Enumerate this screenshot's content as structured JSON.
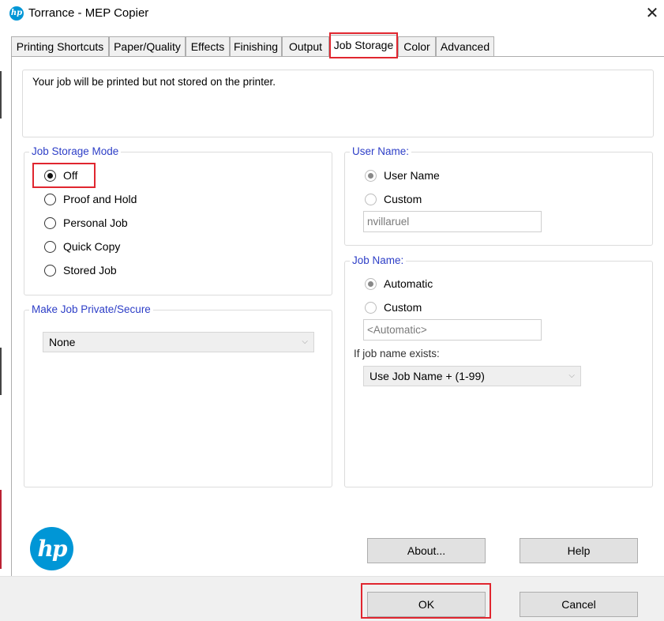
{
  "window": {
    "title": "Torrance - MEP Copier",
    "app_icon": "hp-logo-icon",
    "close_icon": "close-icon"
  },
  "tabs": [
    {
      "label": "Printing Shortcuts"
    },
    {
      "label": "Paper/Quality"
    },
    {
      "label": "Effects"
    },
    {
      "label": "Finishing"
    },
    {
      "label": "Output"
    },
    {
      "label": "Job Storage",
      "active": true
    },
    {
      "label": "Color"
    },
    {
      "label": "Advanced"
    }
  ],
  "description": "Your job will be printed but not stored on the printer.",
  "job_storage_mode": {
    "label": "Job Storage Mode",
    "options": [
      {
        "label": "Off",
        "checked": true
      },
      {
        "label": "Proof and Hold",
        "checked": false
      },
      {
        "label": "Personal Job",
        "checked": false
      },
      {
        "label": "Quick Copy",
        "checked": false
      },
      {
        "label": "Stored Job",
        "checked": false
      }
    ]
  },
  "make_private": {
    "label": "Make Job Private/Secure",
    "selected": "None"
  },
  "user_name": {
    "label": "User Name:",
    "options": [
      {
        "label": "User Name",
        "checked": true
      },
      {
        "label": "Custom",
        "checked": false
      }
    ],
    "field_value": "nvillaruel"
  },
  "job_name": {
    "label": "Job Name:",
    "options": [
      {
        "label": "Automatic",
        "checked": true
      },
      {
        "label": "Custom",
        "checked": false
      }
    ],
    "field_value": "<Automatic>",
    "if_exists_label": "If job name exists:",
    "if_exists_selected": "Use Job Name + (1-99)"
  },
  "buttons": {
    "about": "About...",
    "help": "Help",
    "ok": "OK",
    "cancel": "Cancel"
  },
  "logo_text": "hp",
  "colors": {
    "accent": "#2d3ec7",
    "highlight": "#e0262f",
    "brand": "#0096d6"
  }
}
